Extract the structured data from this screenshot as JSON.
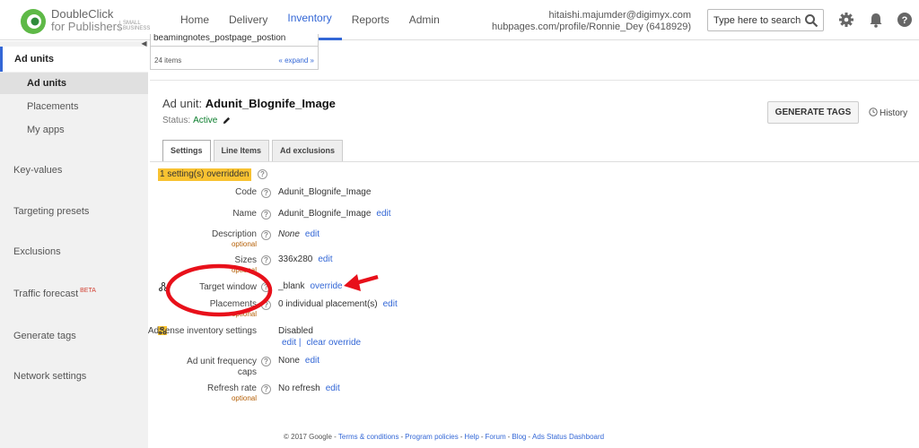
{
  "brand": {
    "line1": "DoubleClick",
    "line2": "for Publishers",
    "tag": "SMALL BUSINESS",
    "logo_color": "#5eb947"
  },
  "nav": {
    "items": [
      "Home",
      "Delivery",
      "Inventory",
      "Reports",
      "Admin"
    ],
    "active_index": 2
  },
  "account": {
    "email": "hitaishi.majumder@digimyx.com",
    "profile": "hubpages.com/profile/Ronnie_Dey (6418929)"
  },
  "search": {
    "placeholder": "Type here to search..."
  },
  "top_icons": [
    "search-icon",
    "gear-icon",
    "bell-icon",
    "help-icon"
  ],
  "sidebar": {
    "section": "Ad units",
    "sub_items": [
      "Ad units",
      "Placements",
      "My apps"
    ],
    "items": [
      "Key-values",
      "Targeting presets",
      "Exclusions",
      "Traffic forecast",
      "Generate tags",
      "Network settings"
    ],
    "beta": "BETA"
  },
  "dropdown": {
    "row": "beamingnotes_postpage_postion",
    "count": "24 items",
    "expand": "« expand »"
  },
  "header": {
    "prefix": "Ad unit:",
    "name": "Adunit_Blognife_Image",
    "status_label": "Status:",
    "status_value": "Active",
    "generate": "GENERATE TAGS",
    "history": "History"
  },
  "tabs": [
    "Settings",
    "Line Items",
    "Ad exclusions"
  ],
  "settings": {
    "overridden": "1 setting(s) overridden",
    "code_label": "Code",
    "code_value": "Adunit_Blognife_Image",
    "name_label": "Name",
    "name_value": "Adunit_Blognife_Image",
    "name_link": "edit",
    "desc_label": "Description",
    "desc_opt": "optional",
    "desc_value": "None",
    "desc_link": "edit",
    "sizes_label": "Sizes",
    "sizes_opt": "optional",
    "sizes_value": "336x280",
    "sizes_link": "edit",
    "target_label": "Target window",
    "target_value": "_blank",
    "target_link": "override",
    "place_label": "Placements",
    "place_opt": "optional",
    "place_value": "0 individual placement(s)",
    "place_link": "edit",
    "adsense_label": "AdSense inventory settings",
    "adsense_value": "Disabled",
    "adsense_edit": "edit |",
    "adsense_clear": "clear override",
    "freq_label1": "Ad unit frequency",
    "freq_label2": "caps",
    "freq_value": "None",
    "freq_link": "edit",
    "refresh_label": "Refresh rate",
    "refresh_opt": "optional",
    "refresh_value": "No refresh",
    "refresh_link": "edit"
  },
  "annotation_color": "#e8101a",
  "footer": {
    "copyright": "© 2017 Google -",
    "links": [
      "Terms & conditions",
      "Program policies",
      "Help",
      "Forum",
      "Blog",
      "Ads Status Dashboard"
    ]
  }
}
